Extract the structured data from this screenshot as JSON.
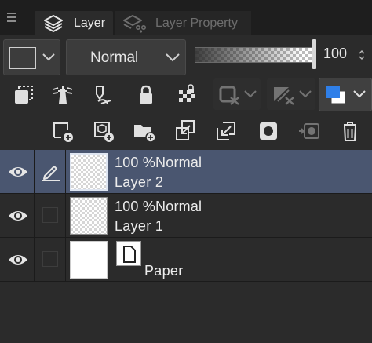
{
  "tabs": [
    {
      "label": "Layer",
      "active": true
    },
    {
      "label": "Layer Property",
      "active": false
    }
  ],
  "blend_mode": {
    "selected": "Normal"
  },
  "opacity": {
    "value": "100",
    "fraction": 1.0
  },
  "colors": {
    "accent_blue": "#2f7fe8",
    "selection": "#4a5670",
    "panel": "#2b2b2b"
  },
  "tool_row1": [
    "layer-mask-icon",
    "reference-layer-icon",
    "draft-layer-icon",
    "lock-icon",
    "lock-transparent-icon",
    "clip-mask-icon",
    "exclude-mask-icon",
    "layer-color-icon"
  ],
  "tool_row2": [
    "new-raster-layer-icon",
    "new-vector-layer-icon",
    "new-folder-icon",
    "transfer-to-lower-icon",
    "combine-lower-icon",
    "create-mask-icon",
    "apply-mask-icon",
    "delete-layer-icon"
  ],
  "layers": [
    {
      "opacity": "100 %",
      "blend": "Normal",
      "name": "Layer 2",
      "selected": true,
      "editing": true
    },
    {
      "opacity": "100 %",
      "blend": "Normal",
      "name": "Layer 1",
      "selected": false,
      "editing": false
    },
    {
      "name": "Paper",
      "is_paper": true
    }
  ]
}
